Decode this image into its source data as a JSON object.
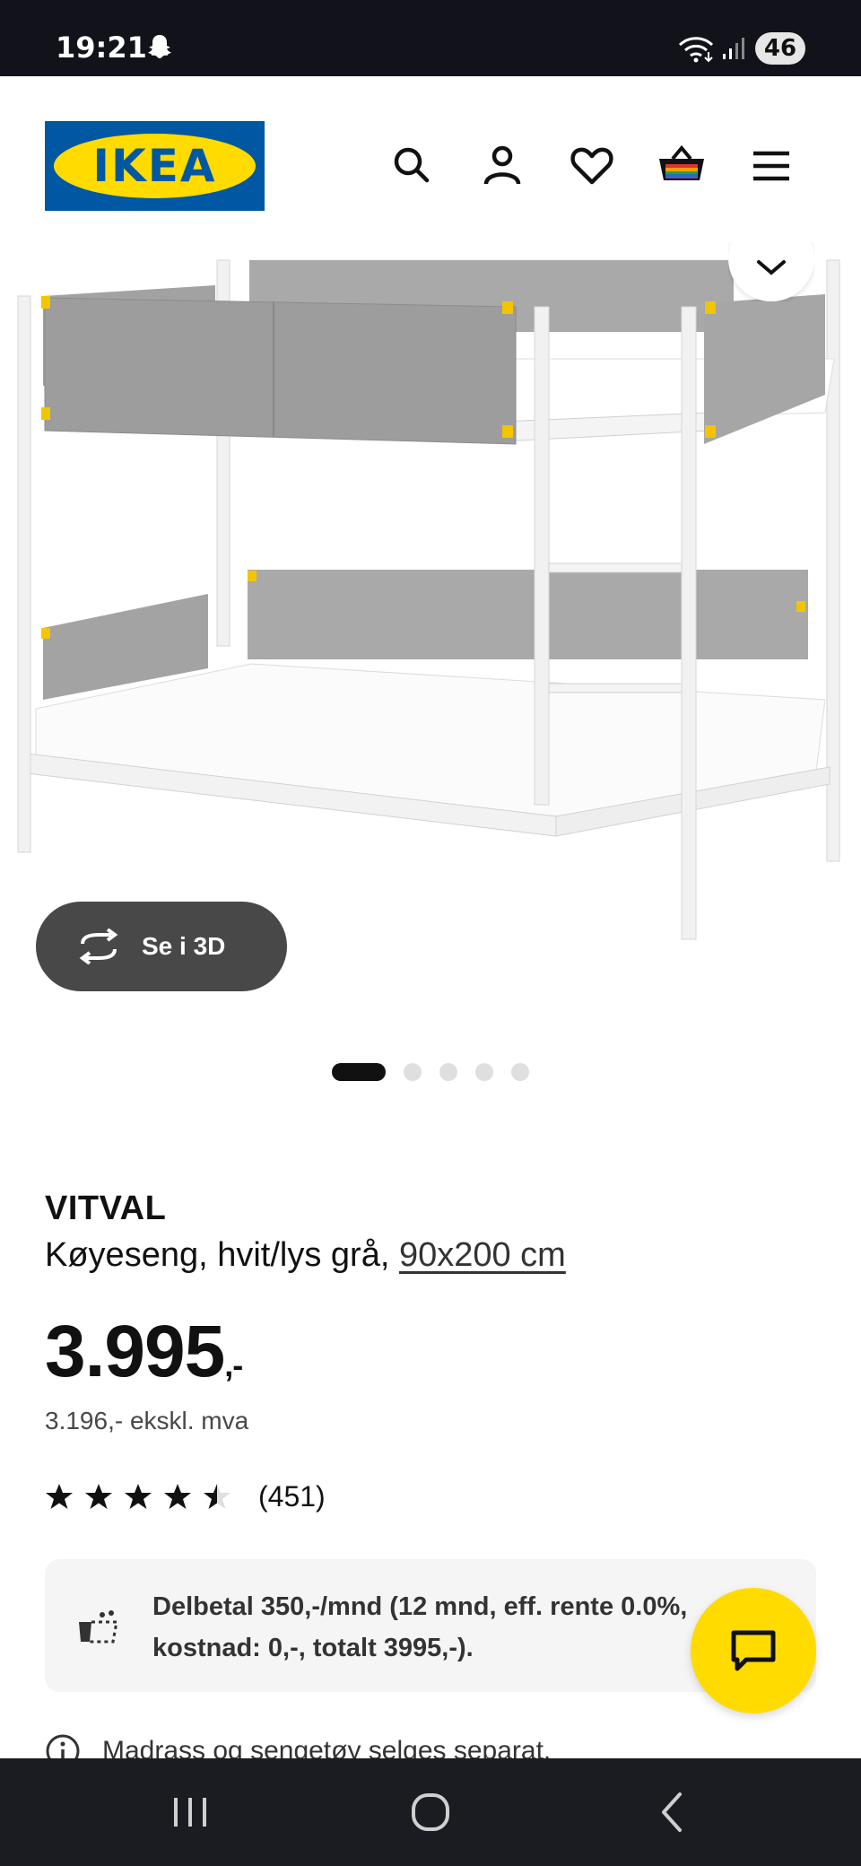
{
  "status_bar": {
    "time": "19:21",
    "battery": "46"
  },
  "header": {
    "logo_text": "IKEA",
    "icons": [
      "search-icon",
      "account-icon",
      "heart-icon",
      "basket-icon",
      "menu-icon"
    ]
  },
  "gallery": {
    "view_3d_label": "Se i 3D",
    "total_images": 5,
    "active_index": 0
  },
  "product": {
    "name": "VITVAL",
    "description": "Køyeseng, hvit/lys grå,",
    "size": "90x200 cm",
    "price_main": "3.995",
    "price_suffix": ",-",
    "price_ex_vat": "3.196,- ekskl. mva",
    "rating": 4.5,
    "rating_max": 5,
    "review_count": "(451)"
  },
  "installment": {
    "text": "Delbetal 350,-/mnd (12 mnd, eff. rente 0.0%, kostnad: 0,-, totalt 3995,-)."
  },
  "note": {
    "text": "Madrass og sengetøy selges separat."
  },
  "colors": {
    "brand_blue": "#0058a3",
    "brand_yellow": "#ffdb00",
    "status_bar": "#12131a",
    "nav_bar": "#1b1c22",
    "button_dark": "#484848"
  }
}
